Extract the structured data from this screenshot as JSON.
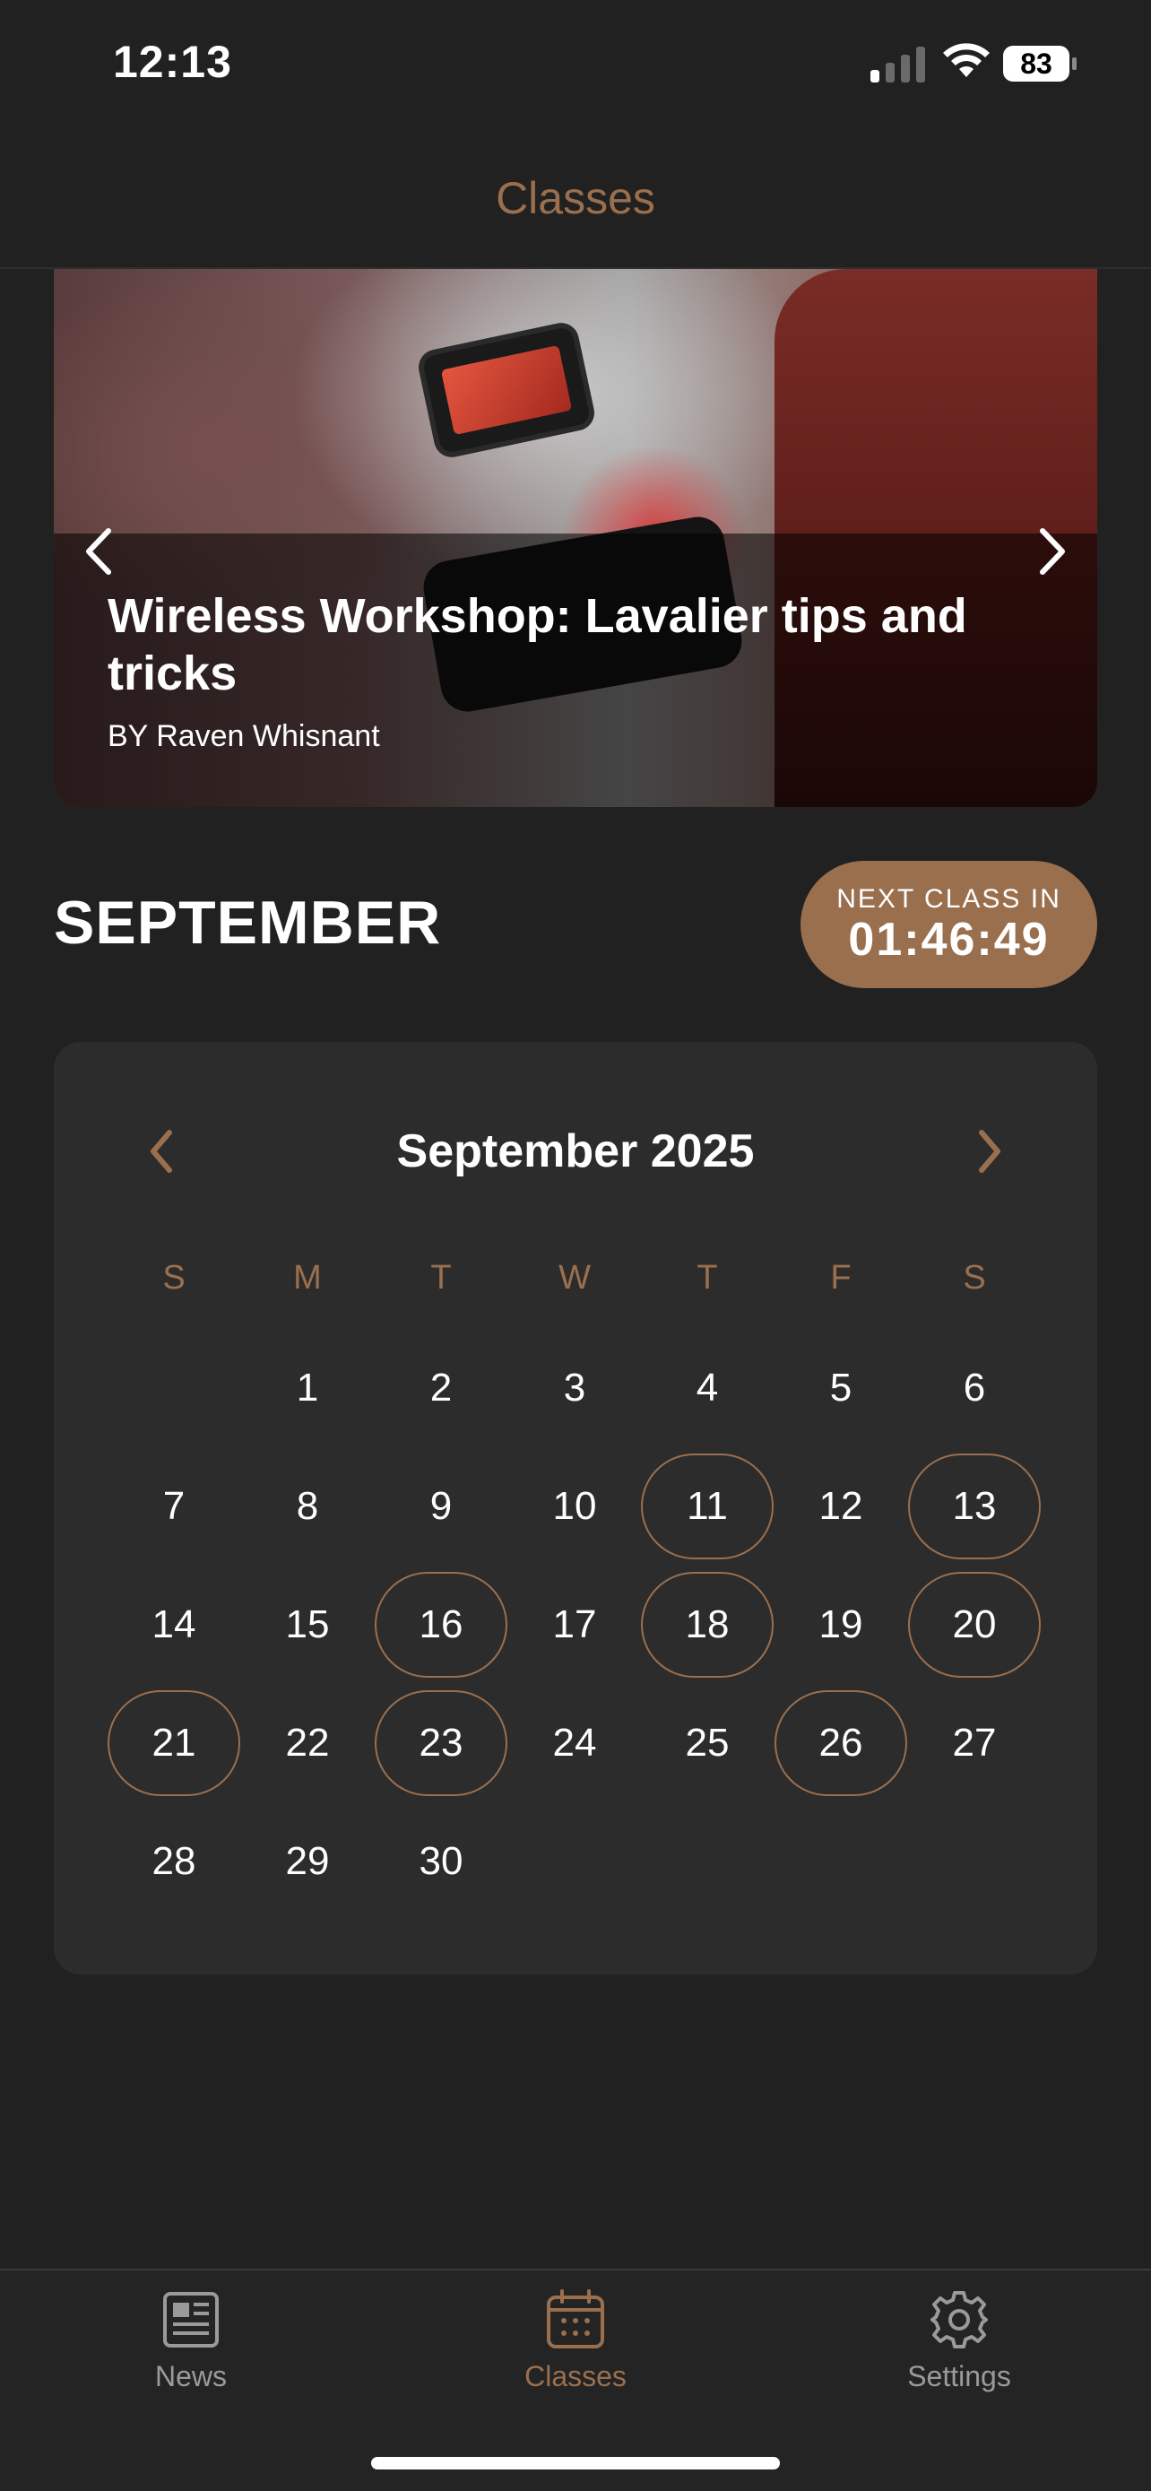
{
  "status_bar": {
    "time": "12:13",
    "battery": "83"
  },
  "header": {
    "title": "Classes"
  },
  "hero": {
    "title": "Wireless Workshop: Lavalier tips and tricks",
    "author": "BY Raven Whisnant"
  },
  "month": {
    "title": "SEPTEMBER"
  },
  "next_class": {
    "label": "NEXT CLASS IN",
    "countdown": "01:46:49"
  },
  "calendar": {
    "title": "September 2025",
    "weekdays": [
      "S",
      "M",
      "T",
      "W",
      "T",
      "F",
      "S"
    ],
    "weeks": [
      [
        "",
        "1",
        "2",
        "3",
        "4",
        "5",
        "6"
      ],
      [
        "7",
        "8",
        "9",
        "10",
        "11",
        "12",
        "13"
      ],
      [
        "14",
        "15",
        "16",
        "17",
        "18",
        "19",
        "20"
      ],
      [
        "21",
        "22",
        "23",
        "24",
        "25",
        "26",
        "27"
      ],
      [
        "28",
        "29",
        "30",
        "",
        "",
        "",
        ""
      ]
    ],
    "class_days": [
      "11",
      "13",
      "16",
      "18",
      "20",
      "21",
      "23",
      "26"
    ]
  },
  "tabbar": {
    "items": [
      {
        "label": "News",
        "icon": "newspaper-icon"
      },
      {
        "label": "Classes",
        "icon": "calendar-icon"
      },
      {
        "label": "Settings",
        "icon": "gear-icon"
      }
    ],
    "active": "Classes"
  },
  "colors": {
    "accent": "#9a6f4e",
    "background": "#212121",
    "card": "#2c2c2c",
    "inactive_tab": "#9a9a9a"
  }
}
